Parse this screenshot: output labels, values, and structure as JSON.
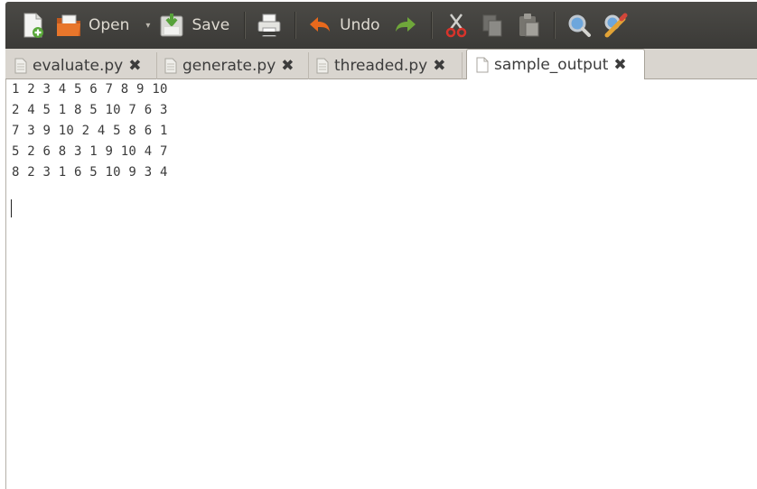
{
  "toolbar": {
    "new_icon": "new-document-icon",
    "open_label": "Open",
    "open_dropdown_glyph": "▾",
    "save_label": "Save",
    "print_icon": "printer-icon",
    "undo_label": "Undo",
    "redo_icon": "redo-icon",
    "cut_icon": "cut-icon",
    "copy_icon": "copy-icon",
    "paste_icon": "paste-icon",
    "find_icon": "search-icon",
    "replace_icon": "find-replace-icon"
  },
  "tabs": [
    {
      "label": "evaluate.py",
      "active": false
    },
    {
      "label": "generate.py",
      "active": false
    },
    {
      "label": "threaded.py",
      "active": false
    },
    {
      "label": "sample_output",
      "active": true
    }
  ],
  "tab_close_glyph": "✖",
  "editor": {
    "lines": [
      "1 2 3 4 5 6 7 8 9 10",
      "2 4 5 1 8 5 10 7 6 3",
      "7 3 9 10 2 4 5 8 6 1",
      "5 2 6 8 3 1 9 10 4 7",
      "8 2 3 1 6 5 10 9 3 4"
    ]
  },
  "colors": {
    "toolbar_bg": "#403f3b",
    "toolbar_text": "#dfdbd2",
    "tabbar_bg": "#d9d5cf",
    "undo_arrow": "#e8691c",
    "redo_arrow": "#6fa73a"
  }
}
